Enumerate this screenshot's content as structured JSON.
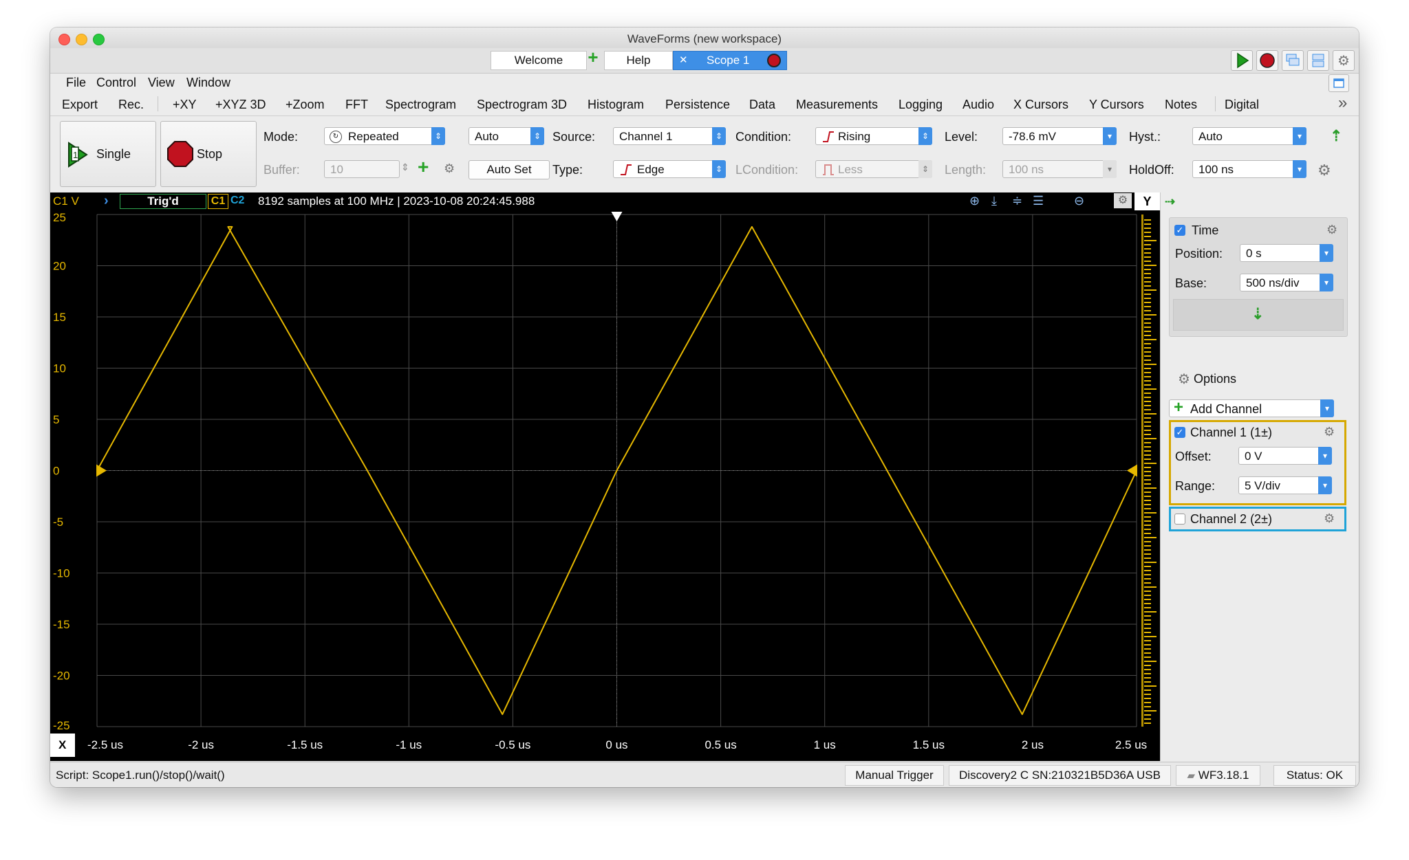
{
  "window": {
    "title": "WaveForms (new workspace)"
  },
  "tabs": {
    "welcome": "Welcome",
    "help": "Help",
    "scope": "Scope 1",
    "plus": "+",
    "close": "✕"
  },
  "menu": [
    "File",
    "Control",
    "View",
    "Window"
  ],
  "tools": [
    "Export",
    "Rec.",
    "+XY",
    "+XYZ 3D",
    "+Zoom",
    "FFT",
    "Spectrogram",
    "Spectrogram 3D",
    "Histogram",
    "Persistence",
    "Data",
    "Measurements",
    "Logging",
    "Audio",
    "X Cursors",
    "Y Cursors",
    "Notes",
    "Digital"
  ],
  "more": "»",
  "controls": {
    "single_label": "Single",
    "stop_label": "Stop",
    "mode_label": "Mode:",
    "mode_value": "Repeated",
    "auto_value": "Auto",
    "buffer_label": "Buffer:",
    "buffer_value": "10",
    "autoset_label": "Auto Set",
    "source_label": "Source:",
    "source_value": "Channel 1",
    "type_label": "Type:",
    "type_value": "Edge",
    "condition_label": "Condition:",
    "condition_value": "Rising",
    "lcondition_label": "LCondition:",
    "lcondition_value": "Less",
    "level_label": "Level:",
    "level_value": "-78.6 mV",
    "length_label": "Length:",
    "length_value": "100 ns",
    "hyst_label": "Hyst.:",
    "hyst_value": "Auto",
    "holdoff_label": "HoldOff:",
    "holdoff_value": "100 ns"
  },
  "plot_header": {
    "c1v": "C1 V",
    "trig": "Trig'd",
    "c1": "C1",
    "c2": "C2",
    "info": "8192 samples at 100 MHz | 2023-10-08 20:24:45.988",
    "y": "Y",
    "x": "X"
  },
  "chart_data": {
    "type": "line",
    "y_ticks": [
      "25",
      "20",
      "15",
      "10",
      "5",
      "0",
      "-5",
      "-10",
      "-15",
      "-20",
      "-25"
    ],
    "x_ticks": [
      "-2.5 us",
      "-2 us",
      "-1.5 us",
      "-1 us",
      "-0.5 us",
      "0 us",
      "0.5 us",
      "1 us",
      "1.5 us",
      "2 us",
      "2.5 us"
    ],
    "xlim": [
      -2.5,
      2.5
    ],
    "ylim": [
      -25,
      25
    ],
    "x_unit": "us",
    "series": [
      {
        "color": "#e6b800",
        "x": [
          -2.5,
          -1.85,
          -1.87,
          -1.2,
          -0.55,
          0.0,
          0.65,
          1.3,
          1.95,
          2.5
        ],
        "y": [
          0,
          23.8,
          23.8,
          0,
          -23.8,
          0,
          23.8,
          0,
          -23.8,
          0
        ]
      }
    ],
    "grid": true
  },
  "panel": {
    "time_label": "Time",
    "position_label": "Position:",
    "position_value": "0 s",
    "base_label": "Base:",
    "base_value": "500 ns/div",
    "options_label": "Options",
    "add_channel_label": "Add Channel",
    "ch1_label": "Channel 1 (1±)",
    "offset_label": "Offset:",
    "offset_value": "0 V",
    "range_label": "Range:",
    "range_value": "5 V/div",
    "ch2_label": "Channel 2 (2±)"
  },
  "status": {
    "script": "Script: Scope1.run()/stop()/wait()",
    "manual_trigger": "Manual Trigger",
    "device": "Discovery2 C SN:210321B5D36A USB",
    "version": "WF3.18.1",
    "status": "Status: OK"
  },
  "colors": {
    "accent": "#3e8fe6",
    "ch1": "#e6b800",
    "ch2": "#1fa3d8",
    "run": "#1e9e1e",
    "stop": "#c1121f"
  }
}
